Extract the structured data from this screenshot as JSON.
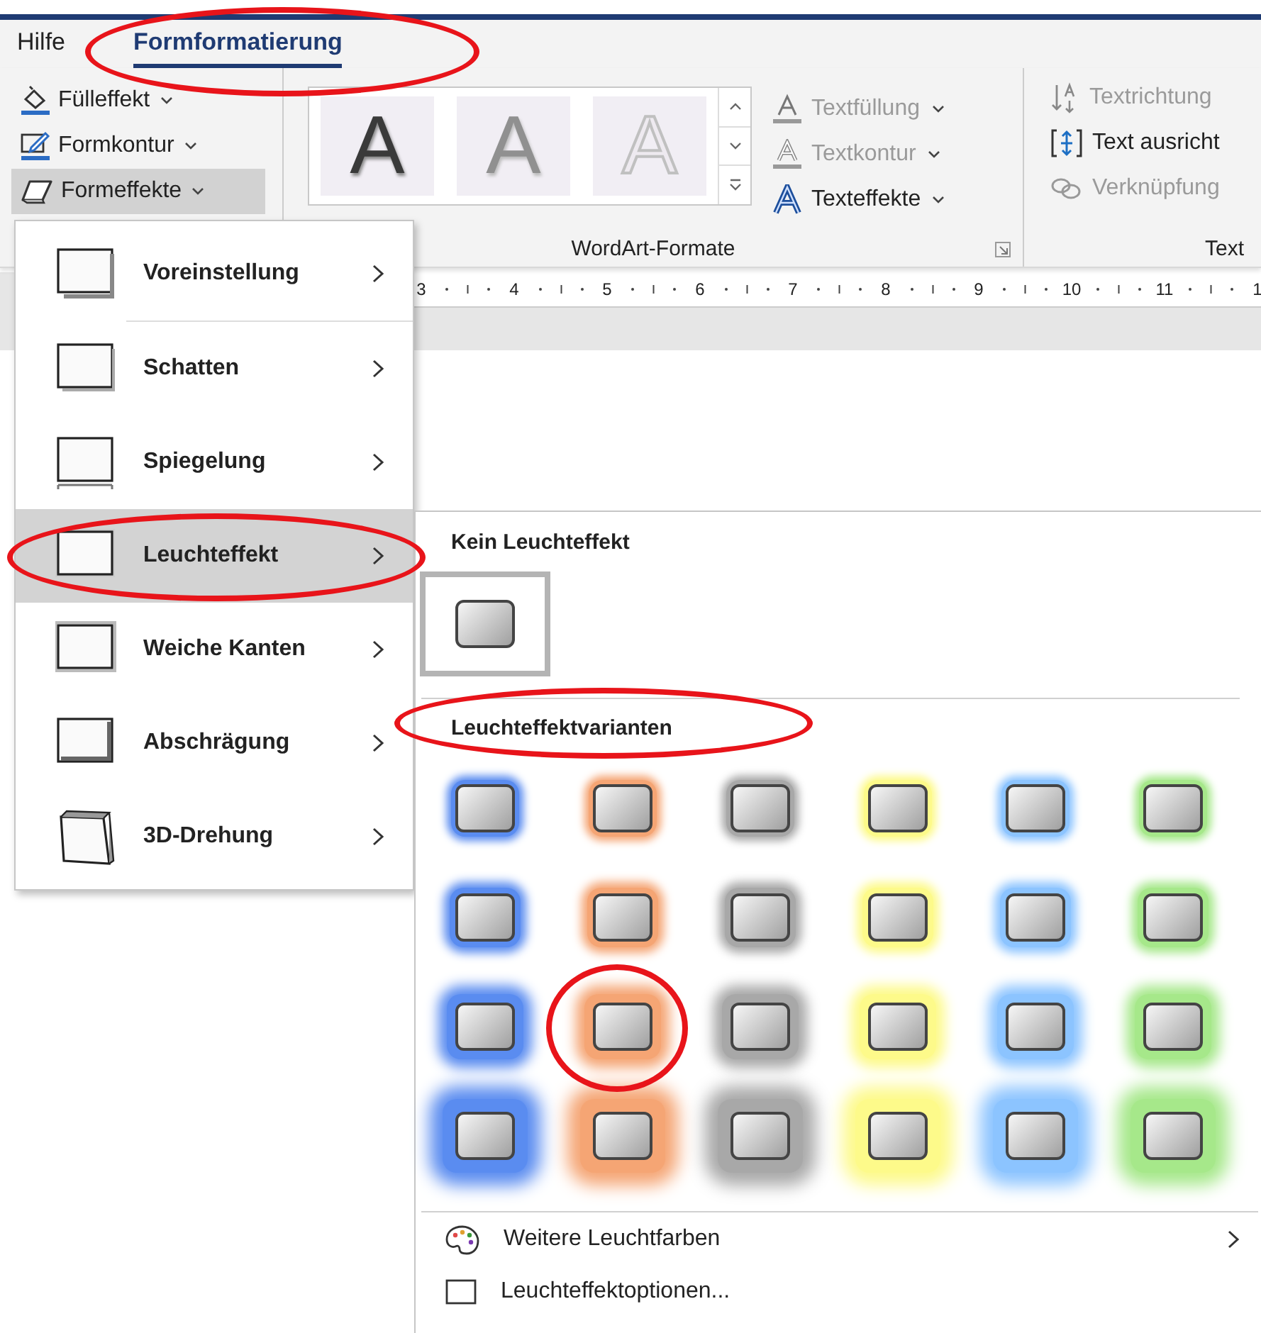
{
  "tabs": [
    {
      "label": "Hilfe",
      "selected": false
    },
    {
      "label": "Formformatierung",
      "selected": true
    }
  ],
  "shape_styles": [
    {
      "kind": "fill",
      "label": "Fülleffekt",
      "pressed": false
    },
    {
      "kind": "outline",
      "label": "Formkontur",
      "pressed": false
    },
    {
      "kind": "effects",
      "label": "Formeffekte",
      "pressed": true
    }
  ],
  "wordart": {
    "label": "WordArt-Formate",
    "styles": [
      {
        "kind": "dark",
        "glyph": "A"
      },
      {
        "kind": "gray",
        "glyph": "A"
      },
      {
        "kind": "outline",
        "glyph": "A"
      }
    ],
    "commands": [
      {
        "kind": "fill",
        "label": "Textfüllung",
        "disabled": true
      },
      {
        "kind": "outline",
        "label": "Textkontur",
        "disabled": true
      },
      {
        "kind": "effects",
        "label": "Texteffekte",
        "disabled": false
      }
    ]
  },
  "text_group": {
    "label": "Text",
    "commands": [
      {
        "kind": "direction",
        "label": "Textrichtung",
        "disabled": true
      },
      {
        "kind": "align",
        "label": "Text ausricht",
        "disabled": false
      },
      {
        "kind": "link",
        "label": "Verknüpfung",
        "disabled": true
      }
    ]
  },
  "ruler": {
    "numbers": [
      "3",
      "4",
      "5",
      "6",
      "7",
      "8",
      "9",
      "10",
      "11",
      "1"
    ]
  },
  "effects_menu": {
    "items": [
      {
        "kind": "preset",
        "label": "Voreinstellung",
        "selected": false
      },
      {
        "kind": "shadow",
        "label": "Schatten",
        "selected": false
      },
      {
        "kind": "reflection",
        "label": "Spiegelung",
        "selected": false
      },
      {
        "kind": "glow",
        "label": "Leuchteffekt",
        "selected": true
      },
      {
        "kind": "soft",
        "label": "Weiche Kanten",
        "selected": false
      },
      {
        "kind": "bevel",
        "label": "Abschrägung",
        "selected": false
      },
      {
        "kind": "rotation",
        "label": "3D-Drehung",
        "selected": false
      }
    ]
  },
  "glow_menu": {
    "none_heading": "Kein Leuchteffekt",
    "none_option": {
      "selected": true
    },
    "variants_heading": "Leuchteffektvarianten",
    "variant_rows": [
      {
        "cells": [
          {
            "color": "#5a8cf0",
            "selected": false
          },
          {
            "color": "#f5a574",
            "selected": false
          },
          {
            "color": "#a8a8a8",
            "selected": false
          },
          {
            "color": "#fdfa8a",
            "selected": false
          },
          {
            "color": "#8cc4ff",
            "selected": false
          },
          {
            "color": "#a6e88a",
            "selected": false
          }
        ]
      },
      {
        "cells": [
          {
            "color": "#5a8cf0",
            "selected": false
          },
          {
            "color": "#f5a574",
            "selected": false
          },
          {
            "color": "#a8a8a8",
            "selected": false
          },
          {
            "color": "#fdfa8a",
            "selected": false
          },
          {
            "color": "#8cc4ff",
            "selected": false
          },
          {
            "color": "#a6e88a",
            "selected": false
          }
        ]
      },
      {
        "cells": [
          {
            "color": "#5a8cf0",
            "selected": false
          },
          {
            "color": "#f5a574",
            "selected": false
          },
          {
            "color": "#a8a8a8",
            "selected": false
          },
          {
            "color": "#fdfa8a",
            "selected": false
          },
          {
            "color": "#8cc4ff",
            "selected": false
          },
          {
            "color": "#a6e88a",
            "selected": false
          }
        ]
      },
      {
        "cells": [
          {
            "color": "#5a8cf0",
            "selected": false
          },
          {
            "color": "#f5a574",
            "selected": false
          },
          {
            "color": "#a8a8a8",
            "selected": false
          },
          {
            "color": "#fdfa8a",
            "selected": false
          },
          {
            "color": "#8cc4ff",
            "selected": false
          },
          {
            "color": "#a6e88a",
            "selected": false
          }
        ]
      }
    ],
    "footer": [
      {
        "kind": "colors",
        "label": "Weitere Leuchtfarben",
        "submenu": true
      },
      {
        "kind": "options",
        "label": "Leuchteffektoptionen...",
        "submenu": false
      }
    ]
  }
}
